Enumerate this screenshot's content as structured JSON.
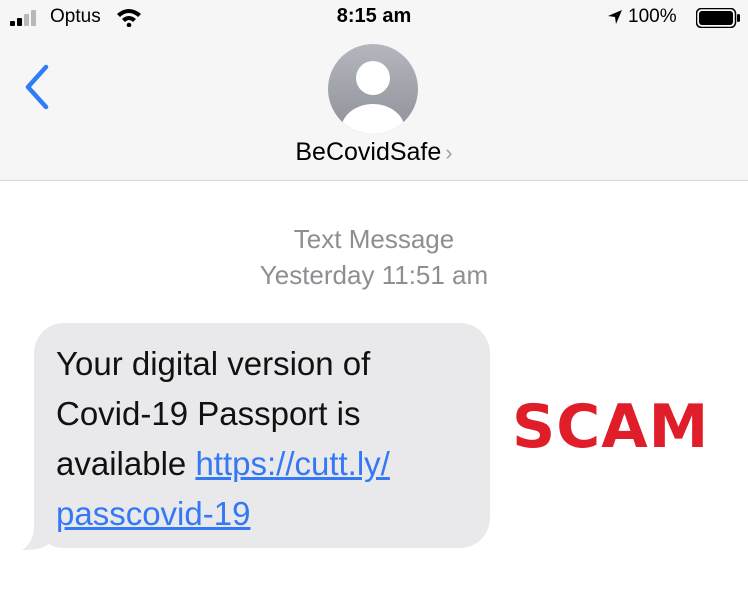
{
  "status_bar": {
    "carrier": "Optus",
    "time": "8:15 am",
    "battery": "100%",
    "icons": [
      "signal-icon",
      "wifi-icon",
      "location-arrow-icon",
      "battery-icon"
    ]
  },
  "header": {
    "back_icon": "chevron-left-icon",
    "avatar_icon": "person-avatar-icon",
    "contact_name": "BeCovidSafe",
    "contact_chevron": "›"
  },
  "conversation": {
    "message_type": "Text Message",
    "timestamp": "Yesterday 11:51 am",
    "message": {
      "text_line1": "Your digital version of",
      "text_line2": "Covid-19 Passport is",
      "text_line3": "available",
      "link_part1": "https://cutt.ly/",
      "link_part2": "passcovid-19"
    }
  },
  "overlay": {
    "label": "SCAM",
    "color": "#e01e2a"
  },
  "colors": {
    "link": "#3478f6",
    "bubble": "#e9e9eb",
    "meta_text": "#8e8e93",
    "header_bg": "#f6f6f6"
  }
}
